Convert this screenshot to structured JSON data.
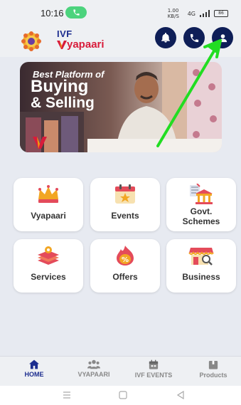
{
  "status": {
    "time": "10:16",
    "right_text": "1.00 KB/S",
    "signal": "4G",
    "battery": "86"
  },
  "header": {
    "logo_top": "IVF",
    "logo_bottom": "yapaari"
  },
  "banner": {
    "line1": "Best Platform of",
    "line2": "Buying",
    "line3": "& Selling"
  },
  "tiles": [
    {
      "label": "Vyapaari",
      "icon": "crown-icon"
    },
    {
      "label": "Events",
      "icon": "calendar-star-icon"
    },
    {
      "label": "Govt. Schemes",
      "icon": "government-building-icon"
    },
    {
      "label": "Services",
      "icon": "layered-services-icon"
    },
    {
      "label": "Offers",
      "icon": "discount-flame-icon"
    },
    {
      "label": "Business",
      "icon": "shop-search-icon"
    }
  ],
  "nav": [
    {
      "label": "HOME",
      "icon": "home-icon"
    },
    {
      "label": "VYAPAARI",
      "icon": "users-icon"
    },
    {
      "label": "IVF EVENTS",
      "icon": "calendar-icon"
    },
    {
      "label": "Products",
      "icon": "box-icon"
    }
  ],
  "colors": {
    "brand_navy": "#0e1e57",
    "brand_red": "#d81b3a",
    "arrow_green": "#22dd22",
    "background": "#e7eaf1"
  }
}
